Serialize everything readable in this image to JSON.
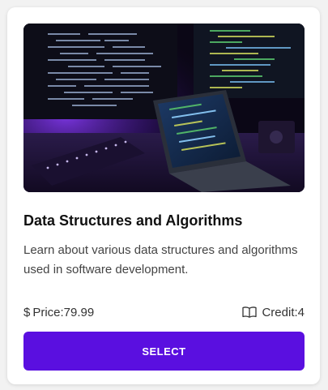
{
  "course": {
    "image_alt": "Computer monitors and laptop showing code",
    "title": "Data Structures and Algorithms",
    "description": "Learn about various data structures and algorithms used in software development.",
    "price_label": "Price:79.99",
    "credit_label": "Credit:4",
    "select_label": "SELECT"
  },
  "icons": {
    "price": "dollar-icon",
    "credit": "book-open-icon"
  },
  "colors": {
    "accent": "#5a0fe0",
    "title": "#111111",
    "text": "#444444"
  }
}
